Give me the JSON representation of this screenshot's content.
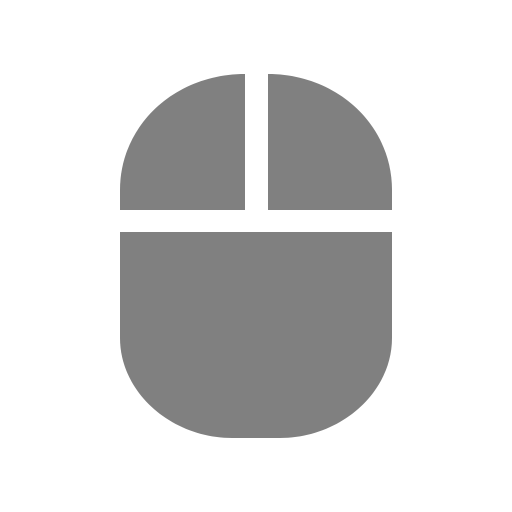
{
  "icon": {
    "name": "mouse-icon",
    "color": "#808080",
    "background": "#ffffff"
  }
}
